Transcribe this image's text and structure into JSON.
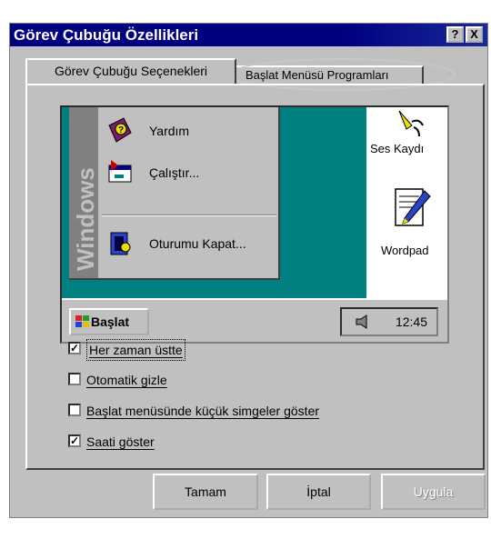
{
  "window": {
    "title": "Görev Çubuğu Özellikleri",
    "help_button": "?",
    "close_button": "X"
  },
  "tabs": [
    {
      "label": "Görev Çubuğu Seçenekleri",
      "active": true
    },
    {
      "label": "Başlat Menüsü Programları",
      "active": false
    }
  ],
  "preview": {
    "banner": "Windows",
    "menu_items": [
      {
        "label": "Yardım"
      },
      {
        "label": "Çalıştır..."
      },
      {
        "label": "Oturumu Kapat..."
      }
    ],
    "desktop_icons": [
      {
        "label": "Ses Kaydı"
      },
      {
        "label": "Wordpad"
      }
    ],
    "start_button": "Başlat",
    "clock": "12:45"
  },
  "options": [
    {
      "label": "Her zaman üstte",
      "checked": true
    },
    {
      "label": "Otomatik gizle",
      "checked": false
    },
    {
      "label": "Başlat menüsünde küçük simgeler göster",
      "checked": false
    },
    {
      "label": "Saati göster",
      "checked": true
    }
  ],
  "buttons": {
    "ok": "Tamam",
    "cancel": "İptal",
    "apply": "Uygula"
  }
}
